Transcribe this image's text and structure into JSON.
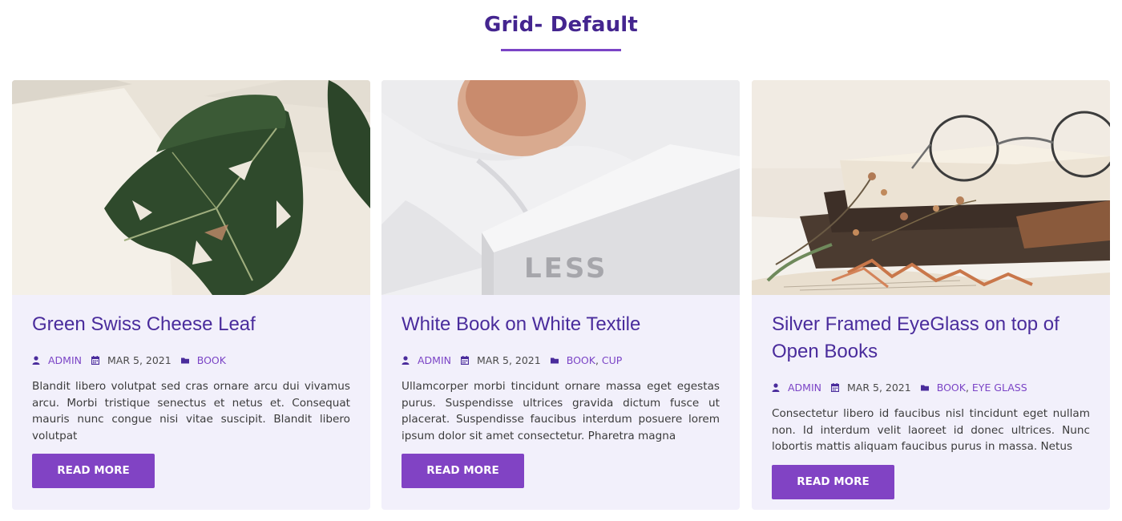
{
  "section": {
    "title": "Grid- Default"
  },
  "colors": {
    "accent": "#7b44c6",
    "title": "#44258f",
    "card_bg": "#f2f0fb",
    "button": "#8143c4"
  },
  "icons": {
    "author": "user-icon",
    "date": "calendar-icon",
    "category": "folder-icon"
  },
  "cards": [
    {
      "title": "Green Swiss Cheese Leaf",
      "author": "ADMIN",
      "date": "MAR 5, 2021",
      "categories": [
        "BOOK"
      ],
      "excerpt": "Blandit libero volutpat sed cras ornare arcu dui vivamus arcu. Morbi tristique senectus et netus et. Consequat mauris nunc congue nisi vitae suscipit. Blandit libero volutpat",
      "button": "READ MORE"
    },
    {
      "title": "White Book on White Textile",
      "author": "ADMIN",
      "date": "MAR 5, 2021",
      "categories": [
        "BOOK",
        "CUP"
      ],
      "excerpt": "Ullamcorper morbi tincidunt ornare massa eget egestas purus. Suspendisse ultrices gravida dictum fusce ut placerat. Suspendisse faucibus interdum posuere lorem ipsum dolor sit amet consectetur. Pharetra magna",
      "button": "READ MORE",
      "image_text": "LESS"
    },
    {
      "title": "Silver Framed EyeGlass on top of Open Books",
      "author": "ADMIN",
      "date": "MAR 5, 2021",
      "categories": [
        "BOOK",
        "EYE GLASS"
      ],
      "excerpt": "Consectetur libero id faucibus nisl tincidunt eget nullam non. Id interdum velit laoreet id donec ultrices. Nunc lobortis mattis aliquam faucibus purus in massa. Netus",
      "button": "READ MORE"
    }
  ]
}
